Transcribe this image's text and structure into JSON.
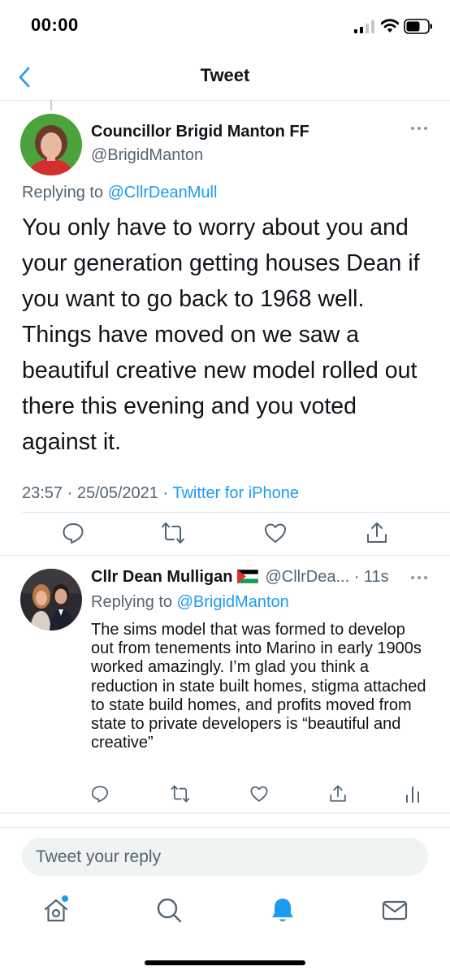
{
  "status_bar": {
    "time": "00:00"
  },
  "nav": {
    "title": "Tweet"
  },
  "main_tweet": {
    "author_name": "Councillor Brigid Manton FF",
    "author_handle": "@BrigidManton",
    "replying_prefix": "Replying to ",
    "replying_handle": "@CllrDeanMull",
    "text": "You only have to worry about you and your generation getting houses Dean if you want to go back to 1968 well. Things have moved on we saw a beautiful creative new model rolled out there this evening and you voted against it.",
    "timestamp": "23:57 · 25/05/2021 · ",
    "source": "Twitter for iPhone"
  },
  "reply_tweet": {
    "author_name": "Cllr Dean Mulligan",
    "author_handle": "@CllrDea...",
    "time_ago": " · 11s",
    "replying_prefix": "Replying to ",
    "replying_handle": "@BrigidManton",
    "text": "The sims model that was formed to develop out from tenements into Marino in early 1900s worked amazingly.  I’m glad you think a reduction in state built homes, stigma attached to state build homes, and profits moved from state to private developers is “beautiful and creative”"
  },
  "compose": {
    "placeholder": "Tweet your reply"
  },
  "icons": {
    "actions": [
      "reply-icon",
      "retweet-icon",
      "like-icon",
      "share-icon",
      "analytics-icon"
    ],
    "tabs": [
      "home-icon",
      "search-icon",
      "notifications-icon",
      "messages-icon"
    ]
  },
  "colors": {
    "accent": "#1d9bf0",
    "secondary_text": "#536471",
    "primary_text": "#0f1419"
  }
}
